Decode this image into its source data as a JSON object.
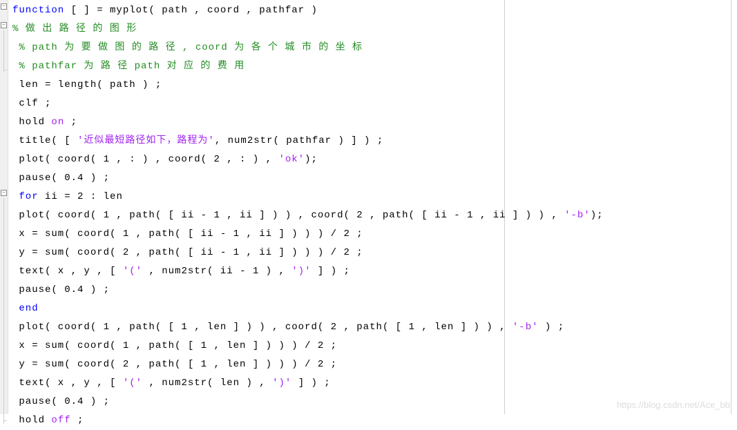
{
  "code": {
    "l1": {
      "a": "function",
      "b": " [ ] = myplot( path , coord , pathfar )"
    },
    "l2": "% 做 出 路 径 的 图 形",
    "l3": " % path 为 要 做 图 的 路 径 , coord 为 各 个 城 市 的 坐 标",
    "l4": " % pathfar 为 路 径 path 对 应 的 费 用",
    "l5": " len = length( path ) ;",
    "l6": " clf ;",
    "l7": {
      "a": " hold ",
      "b": "on",
      "c": " ;"
    },
    "l8": {
      "a": " title( [ ",
      "b": "'近似最短路径如下，路程为'",
      "c": ", num2str( pathfar ) ] ) ;"
    },
    "l9": {
      "a": " plot( coord( 1 , : ) , coord( 2 , : ) , ",
      "b": "'ok'",
      "c": ");"
    },
    "l10": " pause( 0.4 ) ;",
    "l11": {
      "a": " ",
      "b": "for",
      "c": " ii = 2 : len"
    },
    "l12": {
      "a": " plot( coord( 1 , path( [ ii - 1 , ii ] ) ) , coord( 2 , path( [ ii - 1 , ii ] ) ) , ",
      "b": "'-b'",
      "c": ");"
    },
    "l13": " x = sum( coord( 1 , path( [ ii - 1 , ii ] ) ) ) / 2 ;",
    "l14": " y = sum( coord( 2 , path( [ ii - 1 , ii ] ) ) ) / 2 ;",
    "l15": {
      "a": " text( x , y , [ ",
      "b": "'('",
      "c": " , num2str( ii - 1 ) , ",
      "d": "')'",
      "e": " ] ) ;"
    },
    "l16": " pause( 0.4 ) ;",
    "l17": {
      "a": " ",
      "b": "end"
    },
    "l18": {
      "a": " plot( coord( 1 , path( [ 1 , len ] ) ) , coord( 2 , path( [ 1 , len ] ) ) , ",
      "b": "'-b'",
      "c": " ) ;"
    },
    "l19": " x = sum( coord( 1 , path( [ 1 , len ] ) ) ) / 2 ;",
    "l20": " y = sum( coord( 2 , path( [ 1 , len ] ) ) ) / 2 ;",
    "l21": {
      "a": " text( x , y , [ ",
      "b": "'('",
      "c": " , num2str( len ) , ",
      "d": "')'",
      "e": " ] ) ;"
    },
    "l22": " pause( 0.4 ) ;",
    "l23": {
      "a": " hold ",
      "b": "off",
      "c": " ;"
    }
  },
  "watermark": "https://blog.csdn.net/Ace_bb",
  "fold_minus": "−"
}
